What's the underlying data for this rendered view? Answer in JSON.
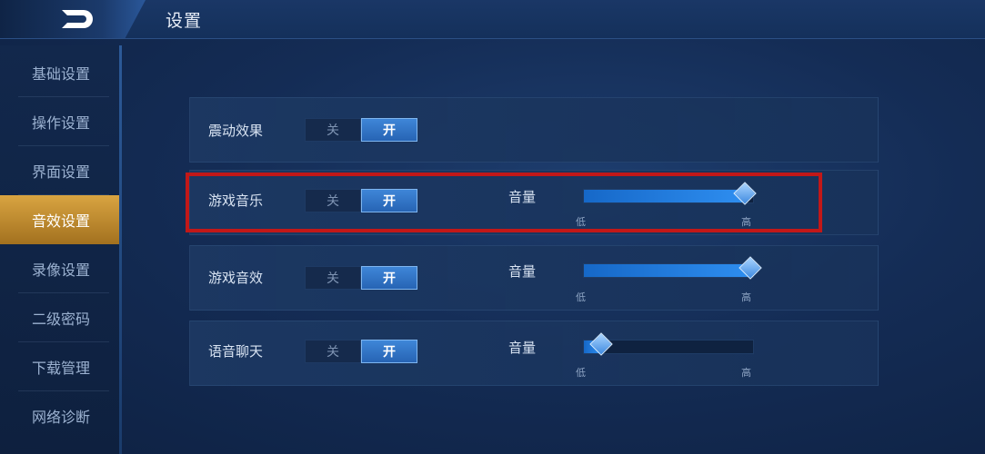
{
  "header": {
    "title": "设置",
    "back_icon": "back-arrow-icon"
  },
  "sidebar": {
    "items": [
      {
        "label": "基础设置",
        "active": false
      },
      {
        "label": "操作设置",
        "active": false
      },
      {
        "label": "界面设置",
        "active": false
      },
      {
        "label": "音效设置",
        "active": true
      },
      {
        "label": "录像设置",
        "active": false
      },
      {
        "label": "二级密码",
        "active": false
      },
      {
        "label": "下载管理",
        "active": false
      },
      {
        "label": "网络诊断",
        "active": false
      }
    ]
  },
  "settings": [
    {
      "label": "震动效果",
      "off": "关",
      "on": "开",
      "state": "on"
    },
    {
      "label": "游戏音乐",
      "off": "关",
      "on": "开",
      "state": "on",
      "volume_label": "音量",
      "low": "低",
      "high": "高",
      "volume": 0.95
    },
    {
      "label": "游戏音效",
      "off": "关",
      "on": "开",
      "state": "on",
      "volume_label": "音量",
      "low": "低",
      "high": "高",
      "volume": 1.0
    },
    {
      "label": "语音聊天",
      "off": "关",
      "on": "开",
      "state": "on",
      "volume_label": "音量",
      "low": "低",
      "high": "高",
      "volume": 0.1
    }
  ],
  "colors": {
    "accent": "#2e8ef0",
    "active_tab": "#d9a441",
    "highlight_box": "#c21818"
  }
}
